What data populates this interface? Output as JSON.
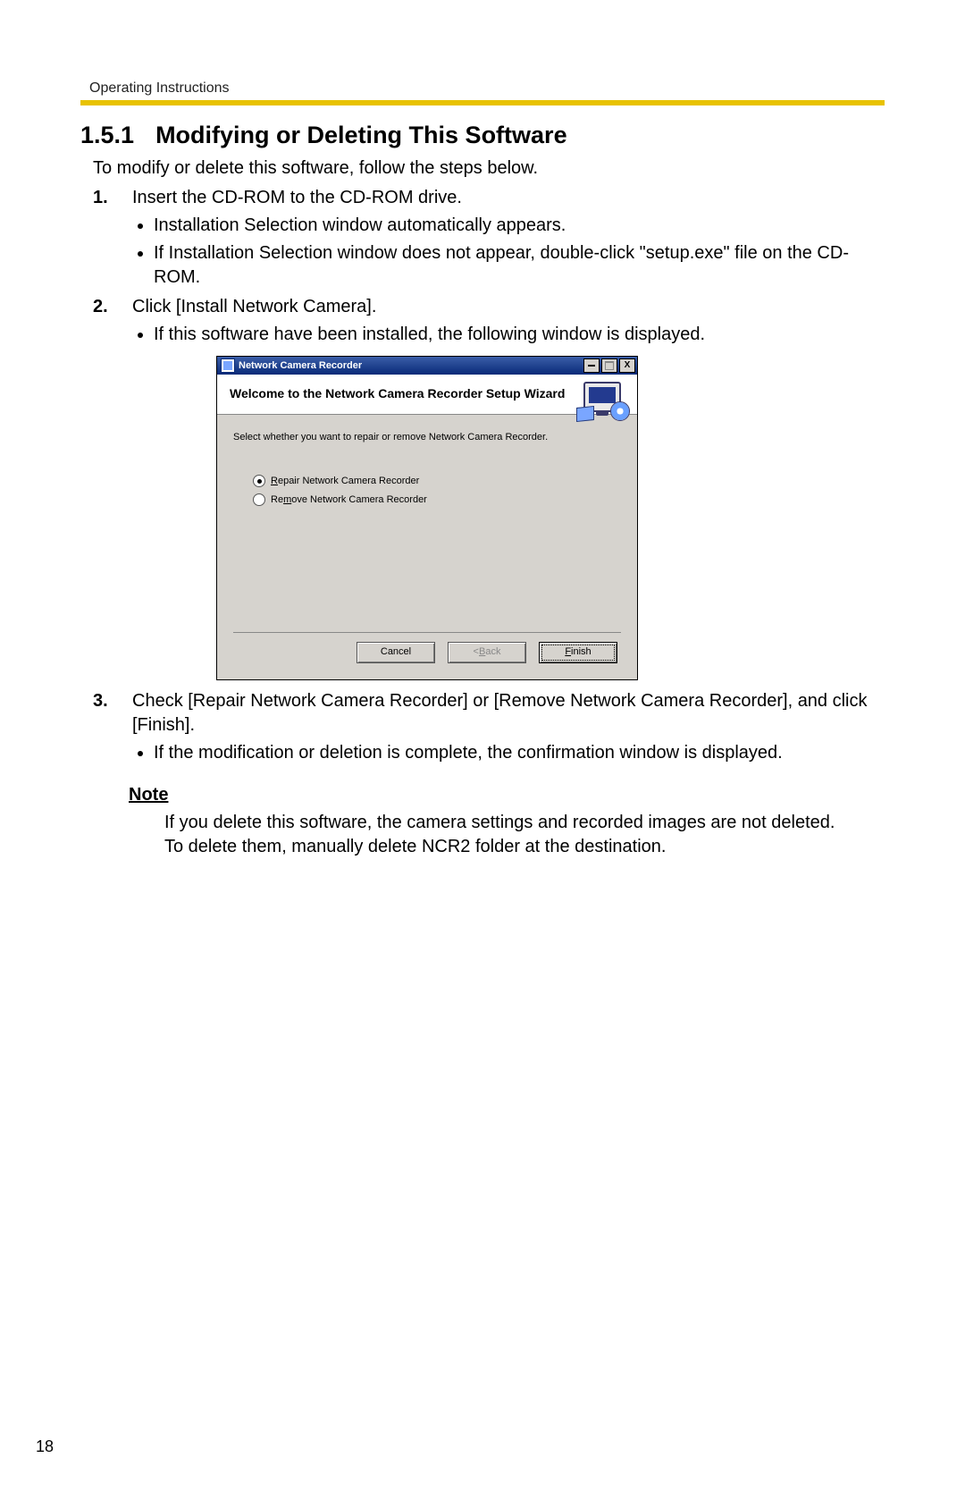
{
  "header": "Operating Instructions",
  "section": {
    "number": "1.5.1",
    "title": "Modifying or Deleting This Software"
  },
  "intro": "To modify or delete this software, follow the steps below.",
  "steps": [
    {
      "num": "1.",
      "text": "Insert the CD-ROM to the CD-ROM drive.",
      "bullets": [
        "Installation Selection window automatically appears.",
        "If Installation Selection window does not appear, double-click \"setup.exe\" file on the CD-ROM."
      ]
    },
    {
      "num": "2.",
      "text": "Click [Install Network Camera].",
      "bullets": [
        "If this software have been installed, the following window is displayed."
      ]
    },
    {
      "num": "3.",
      "text": "Check [Repair Network Camera Recorder] or [Remove Network Camera Recorder], and click [Finish].",
      "bullets": [
        "If the modification or deletion is complete, the confirmation window is displayed."
      ]
    }
  ],
  "note": {
    "heading": "Note",
    "body": "If you delete this software, the camera settings and recorded images are not deleted. To delete them, manually delete NCR2 folder at the destination."
  },
  "pageNumber": "18",
  "installer": {
    "title": "Network Camera Recorder",
    "bannerTitle": "Welcome to the Network Camera Recorder Setup Wizard",
    "instruction": "Select whether you want to repair or remove Network Camera Recorder.",
    "options": {
      "repair": {
        "text": "epair Network Camera Recorder",
        "accel": "R",
        "selected": true
      },
      "remove": {
        "text": "ove Network Camera Recorder",
        "accel": "Rem",
        "accel_u": "m",
        "pre": "Re",
        "selected": false
      }
    },
    "buttons": {
      "cancel": "Cancel",
      "back": {
        "pre": "< ",
        "accel": "B",
        "rest": "ack"
      },
      "finish": {
        "accel": "F",
        "rest": "inish"
      }
    },
    "winControls": {
      "close": "X"
    }
  }
}
